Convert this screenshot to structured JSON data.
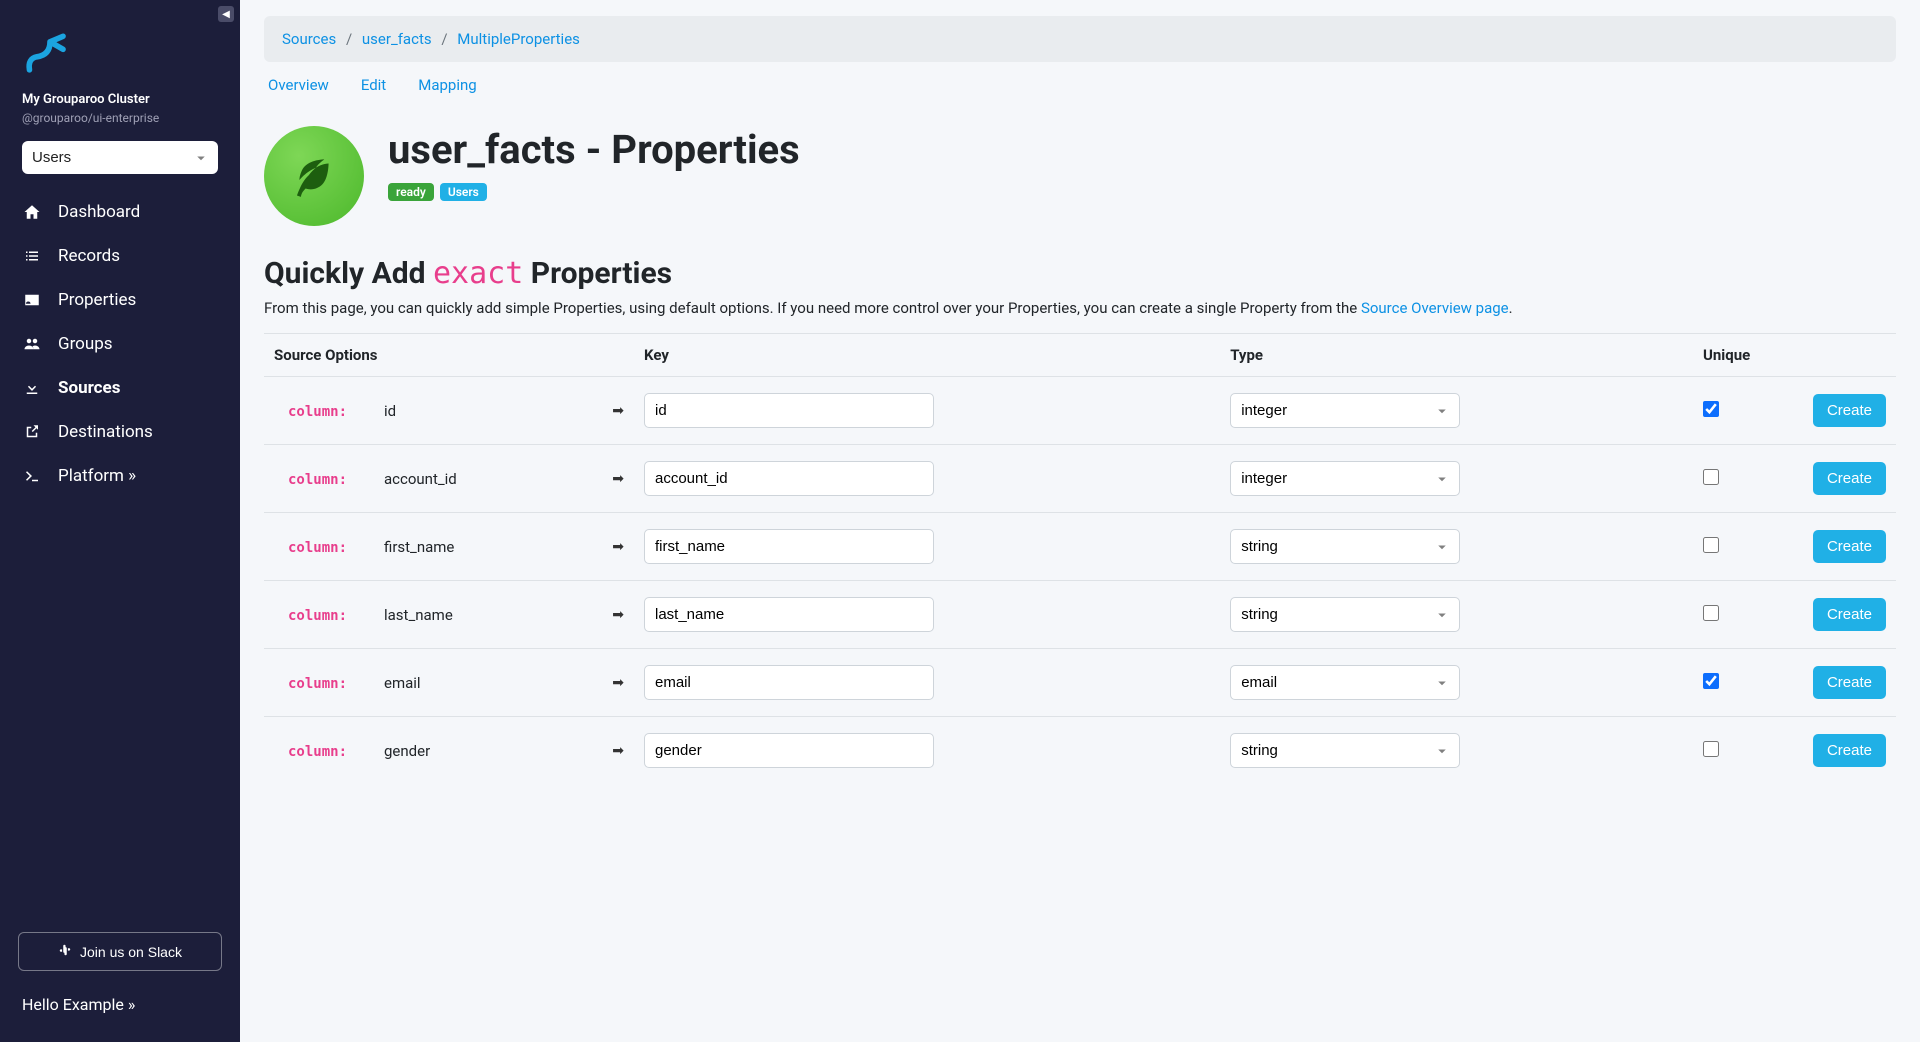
{
  "sidebar": {
    "cluster_name": "My Grouparoo Cluster",
    "cluster_sub": "@grouparoo/ui-enterprise",
    "model_select": "Users",
    "nav": [
      {
        "label": "Dashboard",
        "icon": "home"
      },
      {
        "label": "Records",
        "icon": "list"
      },
      {
        "label": "Properties",
        "icon": "id-card"
      },
      {
        "label": "Groups",
        "icon": "users"
      },
      {
        "label": "Sources",
        "icon": "download",
        "active": true
      },
      {
        "label": "Destinations",
        "icon": "upload"
      },
      {
        "label": "Platform »",
        "icon": "terminal"
      }
    ],
    "slack_btn": "Join us on Slack",
    "hello": "Hello Example »"
  },
  "breadcrumb": {
    "items": [
      "Sources",
      "user_facts",
      "MultipleProperties"
    ]
  },
  "tabs": [
    "Overview",
    "Edit",
    "Mapping"
  ],
  "header": {
    "title": "user_facts - Properties",
    "badge_ready": "ready",
    "badge_model": "Users"
  },
  "section": {
    "title_prefix": "Quickly Add ",
    "title_code": "exact",
    "title_suffix": " Properties",
    "desc_prefix": "From this page, you can quickly add simple Properties, using default options. If you need more control over your Properties, you can create a single Property from the ",
    "desc_link": "Source Overview page",
    "desc_suffix": "."
  },
  "table": {
    "headers": {
      "source_options": "Source Options",
      "key": "Key",
      "type": "Type",
      "unique": "Unique"
    },
    "column_label": "column:",
    "create_label": "Create",
    "rows": [
      {
        "name": "id",
        "key": "id",
        "type": "integer",
        "unique": true
      },
      {
        "name": "account_id",
        "key": "account_id",
        "type": "integer",
        "unique": false
      },
      {
        "name": "first_name",
        "key": "first_name",
        "type": "string",
        "unique": false
      },
      {
        "name": "last_name",
        "key": "last_name",
        "type": "string",
        "unique": false
      },
      {
        "name": "email",
        "key": "email",
        "type": "email",
        "unique": true
      },
      {
        "name": "gender",
        "key": "gender",
        "type": "string",
        "unique": false
      }
    ]
  }
}
